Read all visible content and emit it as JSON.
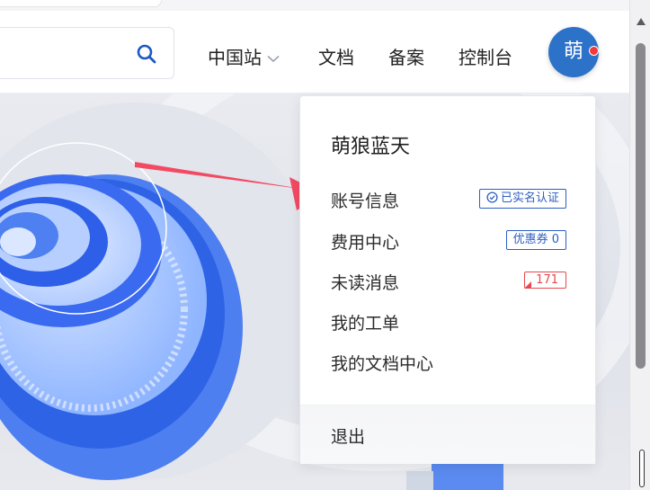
{
  "header": {
    "nav": [
      {
        "label": "中国站",
        "has_dropdown": true
      },
      {
        "label": "文档"
      },
      {
        "label": "备案"
      },
      {
        "label": "控制台"
      }
    ],
    "avatar_initial": "萌",
    "has_notification_dot": true
  },
  "dropdown": {
    "user_name": "萌狼蓝天",
    "items": [
      {
        "label": "账号信息",
        "badge": "已实名认证",
        "badge_icon": "check-circle-icon"
      },
      {
        "label": "费用中心",
        "badge": "优惠券 0"
      },
      {
        "label": "未读消息",
        "badge": "171"
      },
      {
        "label": "我的工单"
      },
      {
        "label": "我的文档中心"
      }
    ],
    "logout_label": "退出"
  },
  "colors": {
    "accent": "#2c5fc0",
    "avatar": "#2d72c9",
    "notification": "#f23a3a",
    "arrow": "#f24a63"
  }
}
